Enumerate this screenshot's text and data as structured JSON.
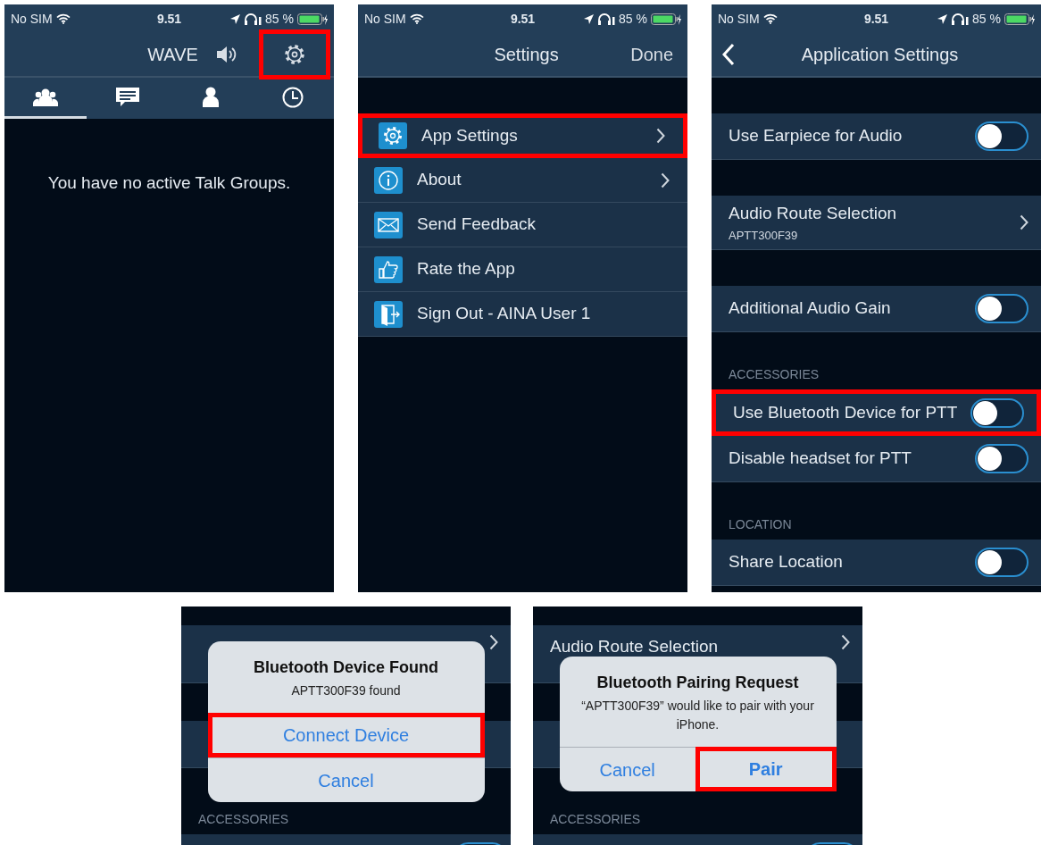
{
  "panels": [
    {
      "kind": "home",
      "status": {
        "carrier": "No SIM",
        "time": "9.51",
        "battery": "85 %"
      },
      "title": "WAVE",
      "settings_highlighted": true,
      "tabs": [
        {
          "selected": true
        },
        {
          "selected": false
        },
        {
          "selected": false
        },
        {
          "selected": false
        }
      ],
      "message": "You have no active Talk Groups."
    },
    {
      "kind": "menu",
      "status": {
        "carrier": "No SIM",
        "time": "9.51",
        "battery": "85 %"
      },
      "title": "Settings",
      "action": "Done",
      "items": [
        {
          "label": "App Settings",
          "chevron": true,
          "highlighted": true
        },
        {
          "label": "About",
          "chevron": true,
          "highlighted": false
        },
        {
          "label": "Send Feedback",
          "chevron": false,
          "highlighted": false
        },
        {
          "label": "Rate the App",
          "chevron": false,
          "highlighted": false
        },
        {
          "label": "Sign Out - AINA User 1",
          "chevron": false,
          "highlighted": false
        }
      ]
    },
    {
      "kind": "settings",
      "status": {
        "carrier": "No SIM",
        "time": "9.51",
        "battery": "85 %"
      },
      "title": "Application Settings",
      "sections": [
        {
          "rows": [
            {
              "kind": "toggle",
              "label": "Use Earpiece for Audio",
              "on": false,
              "highlighted": false
            }
          ]
        },
        {
          "rows": [
            {
              "kind": "nav",
              "label": "Audio Route Selection",
              "detail": "APTT300F39",
              "highlighted": false
            }
          ]
        },
        {
          "rows": [
            {
              "kind": "toggle",
              "label": "Additional Audio Gain",
              "on": false,
              "highlighted": false
            }
          ]
        },
        {
          "header": "ACCESSORIES",
          "rows": [
            {
              "kind": "toggle",
              "label": "Use Bluetooth Device for PTT",
              "on": false,
              "highlighted": true
            },
            {
              "kind": "toggle",
              "label": "Disable headset for PTT",
              "on": false,
              "highlighted": false
            }
          ]
        },
        {
          "header": "LOCATION",
          "rows": [
            {
              "kind": "toggle",
              "label": "Share Location",
              "on": false,
              "highlighted": false
            }
          ]
        }
      ]
    },
    {
      "kind": "alert",
      "sections": [
        {
          "rows": [
            {
              "kind": "nav"
            }
          ]
        },
        {
          "rows": [
            {
              "kind": "blank"
            }
          ]
        },
        {
          "header": "ACCESSORIES",
          "rows": [
            {
              "kind": "toggle",
              "on": false
            }
          ]
        }
      ],
      "alert": {
        "title": "Bluetooth Device Found",
        "message": "APTT300F39 found",
        "kind": "stacked",
        "buttons": [
          {
            "label": "Connect Device",
            "bold": false,
            "highlighted": true
          },
          {
            "label": "Cancel",
            "bold": false,
            "highlighted": false
          }
        ]
      }
    },
    {
      "kind": "alert",
      "sections": [
        {
          "rows": [
            {
              "kind": "nav",
              "label": "Audio Route Selection"
            }
          ]
        },
        {
          "rows": [
            {
              "kind": "blank"
            }
          ]
        },
        {
          "header": "ACCESSORIES",
          "rows": [
            {
              "kind": "toggle",
              "on": false
            }
          ]
        }
      ],
      "alert": {
        "title": "Bluetooth Pairing Request",
        "message": "“APTT300F39” would like to pair with your iPhone.",
        "kind": "side_by_side",
        "buttons": [
          {
            "label": "Cancel",
            "bold": false,
            "highlighted": false
          },
          {
            "label": "Pair",
            "bold": true,
            "highlighted": true
          }
        ]
      }
    }
  ]
}
